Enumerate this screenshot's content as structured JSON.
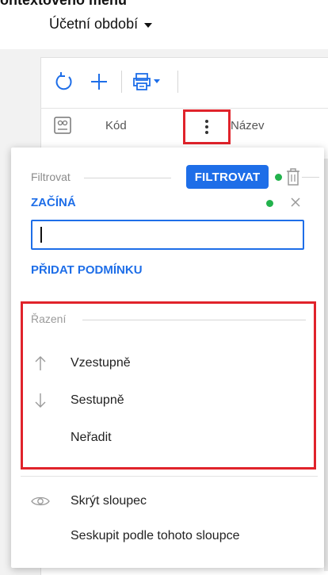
{
  "heading_cut": "ontextového menu",
  "period": {
    "title": "Účetní období"
  },
  "toolbar": {
    "refresh_icon": "refresh-icon",
    "add_icon": "plus-icon",
    "print_icon": "print-dropdown-icon"
  },
  "grid": {
    "columns": [
      {
        "label": "Kód"
      },
      {
        "label": "Název"
      }
    ]
  },
  "popup": {
    "filter": {
      "section_label": "Filtrovat",
      "apply_label": "FILTROVAT",
      "condition_label": "ZAČÍNÁ",
      "input_value": "",
      "add_condition_label": "PŘIDAT PODMÍNKU"
    },
    "sort": {
      "section_label": "Řazení",
      "items": [
        {
          "label": "Vzestupně",
          "icon": "arrow-up-icon"
        },
        {
          "label": "Sestupně",
          "icon": "arrow-down-icon"
        },
        {
          "label": "Neřadit",
          "icon": ""
        }
      ]
    },
    "column_actions": [
      {
        "label": "Skrýt sloupec",
        "icon": "eye-icon"
      },
      {
        "label": "Seskupit podle tohoto sloupce",
        "icon": ""
      }
    ]
  },
  "colors": {
    "accent": "#1e6ee8",
    "highlight": "#e0232b",
    "status_dot": "#22b24c"
  }
}
